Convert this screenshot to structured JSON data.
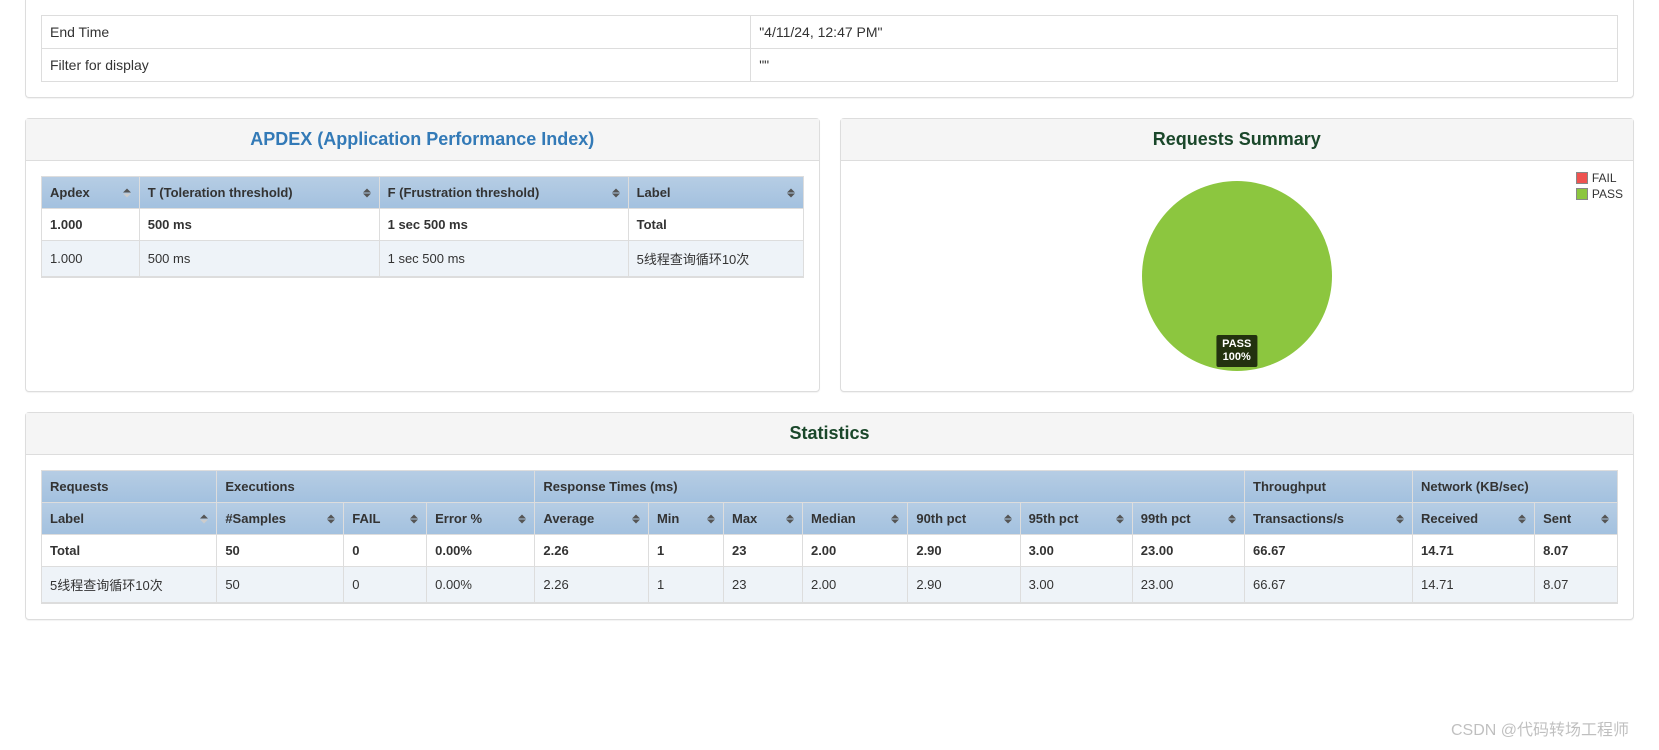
{
  "params": {
    "rows": [
      {
        "label": "End Time",
        "value": "\"4/11/24, 12:47 PM\""
      },
      {
        "label": "Filter for display",
        "value": "\"\""
      }
    ]
  },
  "apdex": {
    "title": "APDEX (Application Performance Index)",
    "headers": [
      "Apdex",
      "T (Toleration threshold)",
      "F (Frustration threshold)",
      "Label"
    ],
    "rows": [
      {
        "apdex": "1.000",
        "t": "500 ms",
        "f": "1 sec 500 ms",
        "label": "Total",
        "bold": true
      },
      {
        "apdex": "1.000",
        "t": "500 ms",
        "f": "1 sec 500 ms",
        "label": "5线程查询循环10次",
        "bold": false
      }
    ]
  },
  "requests_summary": {
    "title": "Requests Summary",
    "legend": {
      "fail": "FAIL",
      "pass": "PASS"
    },
    "pie_label_top": "PASS",
    "pie_label_bottom": "100%"
  },
  "stats": {
    "title": "Statistics",
    "group_headers": [
      "Requests",
      "Executions",
      "Response Times (ms)",
      "Throughput",
      "Network (KB/sec)"
    ],
    "headers": [
      "Label",
      "#Samples",
      "FAIL",
      "Error %",
      "Average",
      "Min",
      "Max",
      "Median",
      "90th pct",
      "95th pct",
      "99th pct",
      "Transactions/s",
      "Received",
      "Sent"
    ],
    "rows": [
      {
        "bold": true,
        "cells": [
          "Total",
          "50",
          "0",
          "0.00%",
          "2.26",
          "1",
          "23",
          "2.00",
          "2.90",
          "3.00",
          "23.00",
          "66.67",
          "14.71",
          "8.07"
        ]
      },
      {
        "bold": false,
        "cells": [
          "5线程查询循环10次",
          "50",
          "0",
          "0.00%",
          "2.26",
          "1",
          "23",
          "2.00",
          "2.90",
          "3.00",
          "23.00",
          "66.67",
          "14.71",
          "8.07"
        ]
      }
    ]
  },
  "chart_data": {
    "type": "pie",
    "title": "Requests Summary",
    "series": [
      {
        "name": "PASS",
        "value": 100,
        "color": "#8cc63f"
      },
      {
        "name": "FAIL",
        "value": 0,
        "color": "#ef5350"
      }
    ]
  },
  "watermark": "CSDN @代码转场工程师"
}
